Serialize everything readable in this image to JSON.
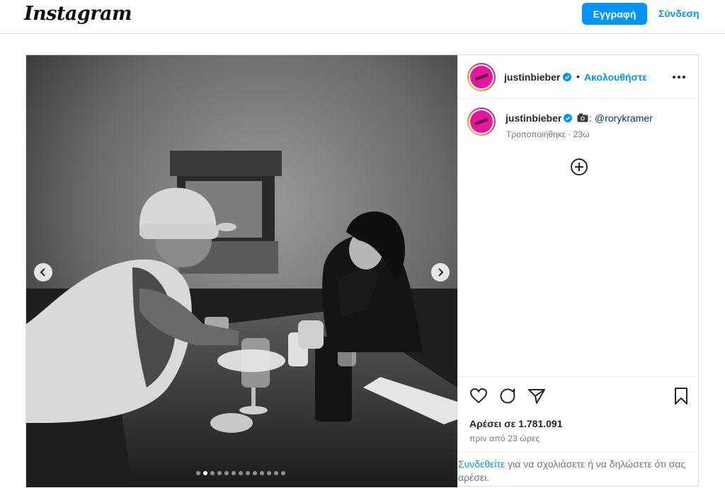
{
  "header": {
    "logo": "Instagram",
    "signup_label": "Εγγραφή",
    "login_label": "Σύνδεση"
  },
  "post": {
    "author": "justinbieber",
    "follow_label": "Ακολουθήστε",
    "separator": "•",
    "caption": {
      "username": "justinbieber",
      "tag": "@rorykramer",
      "edited": "Τροποποιήθηκε · 23ω"
    },
    "likes": "Αρέσει σε 1.781.091",
    "timestamp": "πριν από 23 ώρες",
    "login_prompt_link": "Συνδεθείτε",
    "login_prompt_text": " για να σχολιάσετε ή να δηλώσετε ότι σας αρέσει.",
    "carousel_count": 13,
    "carousel_active": 1
  },
  "colors": {
    "accent": "#0095f6",
    "avatar": "#e6179c"
  },
  "icons": [
    "chevron-left-icon",
    "chevron-right-icon",
    "verified-badge-icon",
    "more-options-icon",
    "camera-icon",
    "add-circle-icon",
    "heart-icon",
    "comment-icon",
    "share-icon",
    "bookmark-icon"
  ]
}
